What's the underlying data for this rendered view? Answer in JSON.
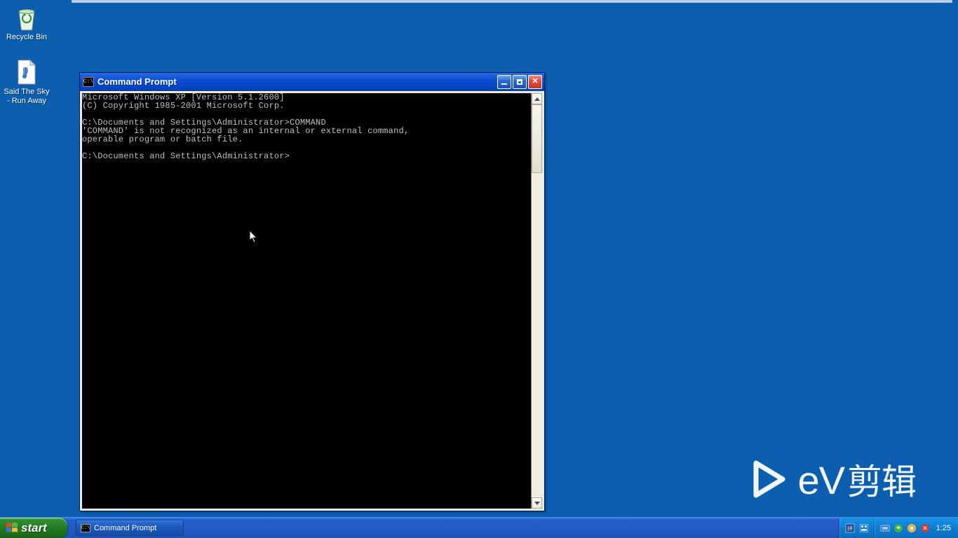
{
  "desktop": {
    "icons": [
      {
        "name": "recycle-bin",
        "label": "Recycle Bin"
      },
      {
        "name": "music-file",
        "label": "Said The Sky - Run Away"
      }
    ]
  },
  "window": {
    "title": "Command Prompt",
    "title_icon_text": "C:\\",
    "terminal_lines": [
      "Microsoft Windows XP [Version 5.1.2600]",
      "(C) Copyright 1985-2001 Microsoft Corp.",
      "",
      "C:\\Documents and Settings\\Administrator>COMMAND",
      "'COMMAND' is not recognized as an internal or external command,",
      "operable program or batch file.",
      "",
      "C:\\Documents and Settings\\Administrator>"
    ],
    "buttons": {
      "min": "minimize",
      "max": "maximize",
      "close": "close"
    }
  },
  "watermark": {
    "brand_latin": "eV",
    "brand_cjk": "剪辑"
  },
  "taskbar": {
    "start_label": "start",
    "task_item_label": "Command Prompt",
    "clock": "1:25"
  }
}
